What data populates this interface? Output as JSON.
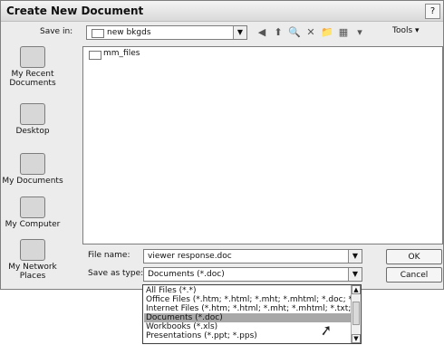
{
  "dialog": {
    "title": "Create New Document",
    "help_icon": "?",
    "save_in_label": "Save in:",
    "save_in_value": "new bkgds",
    "toolbar": {
      "tools_label": "Tools"
    }
  },
  "places": [
    {
      "label": "My Recent Documents",
      "icon": "recent-docs-icon"
    },
    {
      "label": "Desktop",
      "icon": "desktop-icon"
    },
    {
      "label": "My Documents",
      "icon": "documents-icon"
    },
    {
      "label": "My Computer",
      "icon": "computer-icon"
    },
    {
      "label": "My Network Places",
      "icon": "network-icon"
    }
  ],
  "files": [
    {
      "name": "mm_files",
      "type": "folder"
    }
  ],
  "fields": {
    "file_name_label": "File name:",
    "file_name_value": "viewer response.doc",
    "save_as_label": "Save as type:",
    "save_as_value": "Documents (*.doc)"
  },
  "buttons": {
    "ok": "OK",
    "cancel": "Cancel"
  },
  "dropdown_options": [
    "All Files (*.*)",
    "Office Files (*.htm; *.html; *.mht; *.mhtml; *.doc; *.xls; *",
    "Internet Files (*.htm; *.html; *.mht; *.mhtml; *.txt; *.gif;",
    "Documents (*.doc)",
    "Workbooks (*.xls)",
    "Presentations (*.ppt; *.pps)"
  ],
  "dropdown_selected_index": 3
}
